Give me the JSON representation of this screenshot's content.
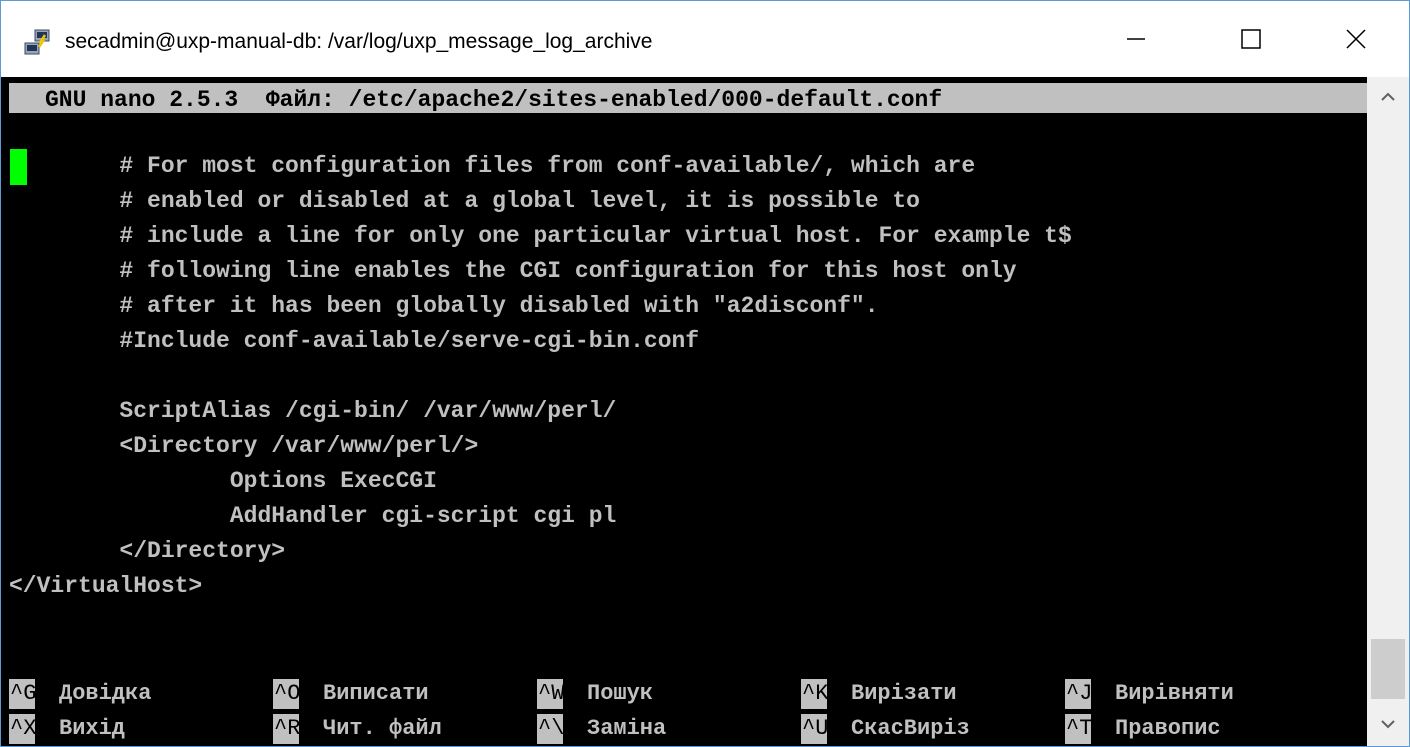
{
  "window": {
    "title": "secadmin@uxp-manual-db: /var/log/uxp_message_log_archive",
    "icon": "putty-icon",
    "controls": {
      "minimize": "minimize-icon",
      "maximize": "maximize-icon",
      "close": "close-icon"
    }
  },
  "nano": {
    "header": "GNU nano 2.5.3  Файл: /etc/apache2/sites-enabled/000-default.conf",
    "lines": [
      "        # For most configuration files from conf-available/, which are",
      "        # enabled or disabled at a global level, it is possible to",
      "        # include a line for only one particular virtual host. For example t$",
      "        # following line enables the CGI configuration for this host only",
      "        # after it has been globally disabled with \"a2disconf\".",
      "        #Include conf-available/serve-cgi-bin.conf",
      "",
      "        ScriptAlias /cgi-bin/ /var/www/perl/",
      "        <Directory /var/www/perl/>",
      "                Options ExecCGI",
      "                AddHandler cgi-script cgi pl",
      "        </Directory>",
      "</VirtualHost>"
    ],
    "shortcuts_row1": [
      {
        "key": "^G",
        "label": "Довідка"
      },
      {
        "key": "^O",
        "label": "Виписати"
      },
      {
        "key": "^W",
        "label": "Пошук"
      },
      {
        "key": "^K",
        "label": "Вирізати"
      },
      {
        "key": "^J",
        "label": "Вирівняти"
      }
    ],
    "shortcuts_row2": [
      {
        "key": "^X",
        "label": "Вихід"
      },
      {
        "key": "^R",
        "label": "Чит. файл"
      },
      {
        "key": "^\\",
        "label": "Заміна"
      },
      {
        "key": "^U",
        "label": "СкасВиріз"
      },
      {
        "key": "^T",
        "label": "Правопис"
      }
    ]
  },
  "colors": {
    "terminal_bg": "#000000",
    "terminal_fg": "#c0c0c0",
    "cursor": "#00ff00",
    "header_bg": "#c0c0c0"
  }
}
